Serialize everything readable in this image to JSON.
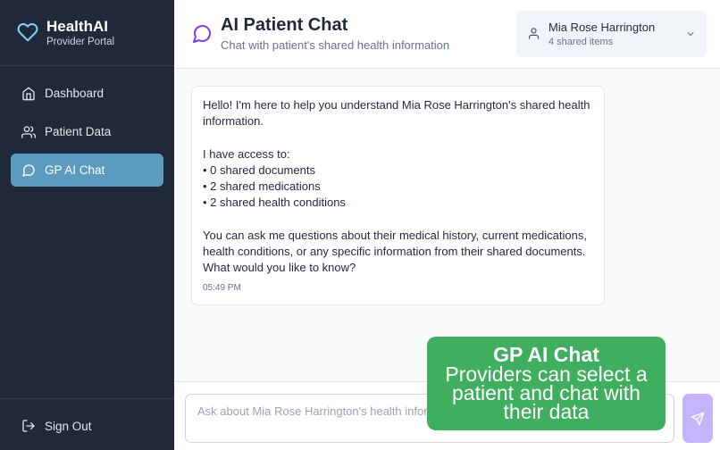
{
  "brand": {
    "name": "HealthAI",
    "subtitle": "Provider Portal"
  },
  "nav": {
    "items": [
      {
        "label": "Dashboard",
        "icon": "home-icon",
        "active": false
      },
      {
        "label": "Patient Data",
        "icon": "users-icon",
        "active": false
      },
      {
        "label": "GP AI Chat",
        "icon": "chat-icon",
        "active": true
      }
    ],
    "signout": "Sign Out"
  },
  "header": {
    "title": "AI Patient Chat",
    "subtitle": "Chat with patient's shared health information"
  },
  "patient_selector": {
    "name": "Mia Rose Harrington",
    "count": "4 shared items"
  },
  "message": {
    "lines": [
      "Hello! I'm here to help you understand Mia Rose Harrington's shared health",
      "information.",
      "",
      "I have access to:",
      "• 0 shared documents",
      "• 2 shared medications",
      "• 2 shared health conditions",
      "",
      "You can ask me questions about their medical history, current medications,",
      "health conditions, or any specific information from their shared documents.",
      "What would you like to know?"
    ],
    "time": "05:49 PM"
  },
  "input": {
    "placeholder": "Ask about Mia Rose Harrington's health information..."
  },
  "overlay": {
    "title": "GP AI Chat",
    "lines": [
      "Providers can select a",
      "patient and chat with",
      "their data"
    ]
  },
  "colors": {
    "sidebar": "#1f2937",
    "active_nav": "#5b9bbf",
    "accent": "#7c3aed",
    "send_button": "#c4b5fd",
    "overlay": "#3fae5f"
  }
}
